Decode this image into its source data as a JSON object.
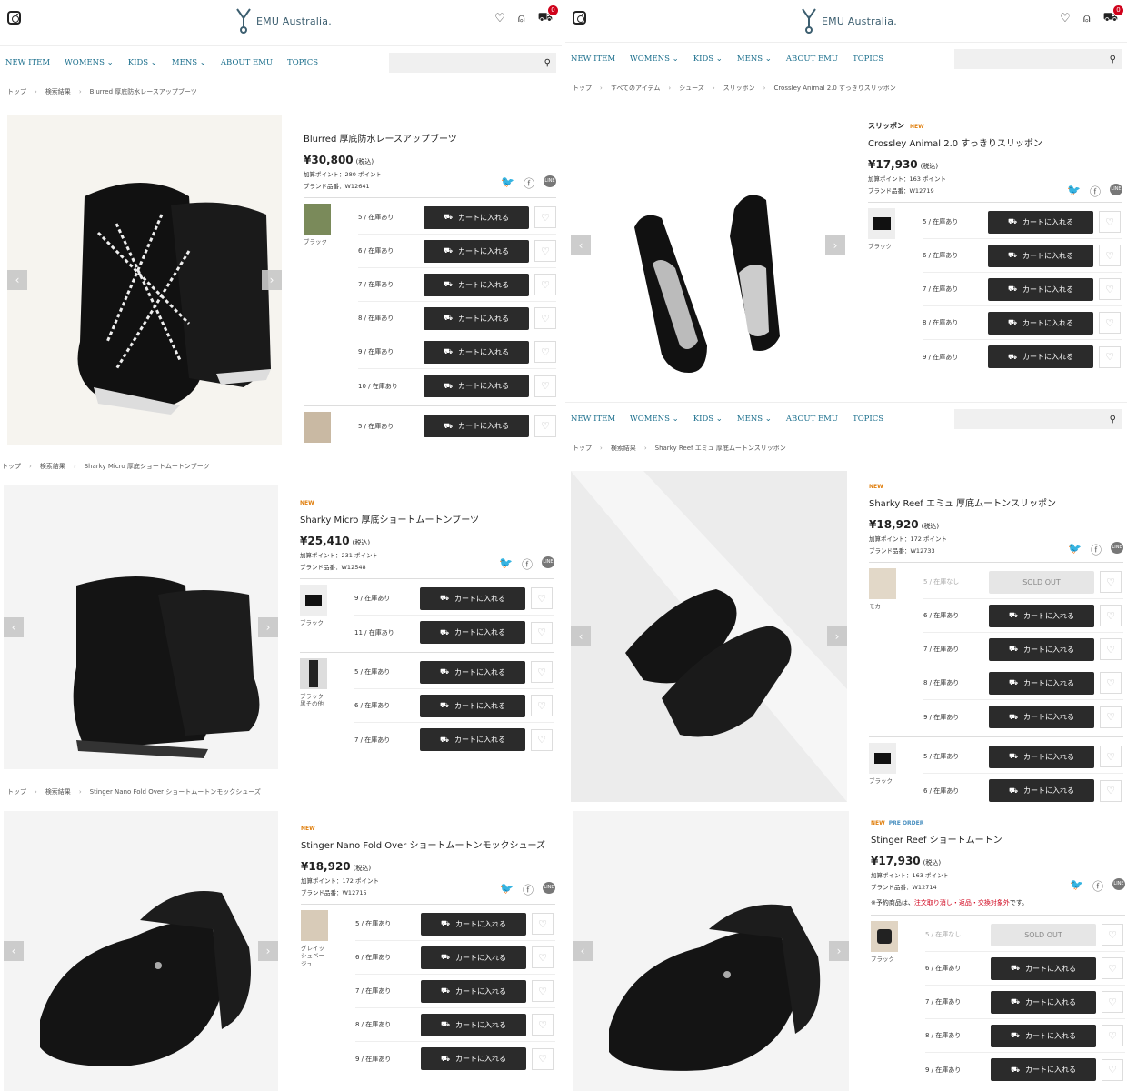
{
  "brand": {
    "logo_text": "EMU Australia."
  },
  "cart_badge": "0",
  "nav": [
    "NEW ITEM",
    "WOMENS ⌄",
    "KIDS ⌄",
    "MENS ⌄",
    "ABOUT EMU",
    "TOPICS"
  ],
  "icons": {
    "search": "⚲",
    "heart": "♡",
    "user": "⍝",
    "cart": "🛒"
  },
  "cart_label": "カートに入れる",
  "sold_label": "SOLD OUT",
  "tax_label": "(税込)",
  "line_label": "LINE",
  "p1": {
    "crumbs": [
      "トップ",
      "検索結果",
      "Blurred 厚底防水レースアップブーツ"
    ],
    "title": "Blurred 厚底防水レースアップブーツ",
    "price": "¥30,800",
    "points": "加算ポイント：280 ポイント",
    "sku": "ブランド品番：W12641",
    "color": "ブラック",
    "sizes": [
      "5 / 在庫あり",
      "6 / 在庫あり",
      "7 / 在庫あり",
      "8 / 在庫あり",
      "9 / 在庫あり",
      "10 / 在庫あり"
    ],
    "sizes2": [
      "5 / 在庫あり"
    ]
  },
  "p2": {
    "crumbs": [
      "トップ",
      "検索結果",
      "Sharky Micro 厚底ショートムートンブーツ"
    ],
    "new": "NEW",
    "title": "Sharky Micro 厚底ショートムートンブーツ",
    "price": "¥25,410",
    "points": "加算ポイント：231 ポイント",
    "sku": "ブランド品番：W12548",
    "color": "ブラック",
    "color2": "ブラック 黒その他",
    "sizes": [
      "9 / 在庫あり",
      "11 / 在庫あり"
    ],
    "sizes2": [
      "5 / 在庫あり",
      "6 / 在庫あり",
      "7 / 在庫あり"
    ]
  },
  "p3": {
    "crumbs": [
      "トップ",
      "検索結果",
      "Stinger Nano Fold Over ショートムートンモックシューズ"
    ],
    "new": "NEW",
    "title": "Stinger Nano Fold Over ショートムートンモックシューズ",
    "price": "¥18,920",
    "points": "加算ポイント：172 ポイント",
    "sku": "ブランド品番：W12715",
    "color": "グレイッシュベージュ",
    "sizes": [
      "5 / 在庫あり",
      "6 / 在庫あり",
      "7 / 在庫あり",
      "8 / 在庫あり",
      "9 / 在庫あり"
    ]
  },
  "p4": {
    "crumbs": [
      "トップ",
      "すべてのアイテム",
      "シューズ",
      "スリッポン",
      "Crossley Animal 2.0 すっきりスリッポン"
    ],
    "cat": "スリッポン",
    "new": "NEW",
    "title": "Crossley Animal 2.0 すっきりスリッポン",
    "price": "¥17,930",
    "points": "加算ポイント：163 ポイント",
    "sku": "ブランド品番：W12719",
    "color": "ブラック",
    "sizes": [
      "5 / 在庫あり",
      "6 / 在庫あり",
      "7 / 在庫あり",
      "8 / 在庫あり",
      "9 / 在庫あり"
    ]
  },
  "p5": {
    "crumbs": [
      "トップ",
      "検索結果",
      "Sharky Reef エミュ 厚底ムートンスリッポン"
    ],
    "new": "NEW",
    "title": "Sharky Reef エミュ 厚底ムートンスリッポン",
    "price": "¥18,920",
    "points": "加算ポイント：172 ポイント",
    "sku": "ブランド品番：W12733",
    "color": "モカ",
    "color2": "ブラック",
    "sold_size": "5 / 在庫なし",
    "sizes": [
      "6 / 在庫あり",
      "7 / 在庫あり",
      "8 / 在庫あり",
      "9 / 在庫あり"
    ],
    "sizes2": [
      "5 / 在庫あり",
      "6 / 在庫あり"
    ]
  },
  "p6": {
    "new": "NEW",
    "pre": "PRE ORDER",
    "title": "Stinger Reef ショートムートン",
    "price": "¥17,930",
    "points": "加算ポイント：163 ポイント",
    "sku": "ブランド品番：W12714",
    "note_a": "※予約商品は、",
    "note_red": "注文取り消し・返品・交換対象外",
    "note_b": "です。",
    "color": "ブラック",
    "sold_size": "5 / 在庫なし",
    "sizes": [
      "6 / 在庫あり",
      "7 / 在庫あり",
      "8 / 在庫あり",
      "9 / 在庫あり"
    ]
  }
}
